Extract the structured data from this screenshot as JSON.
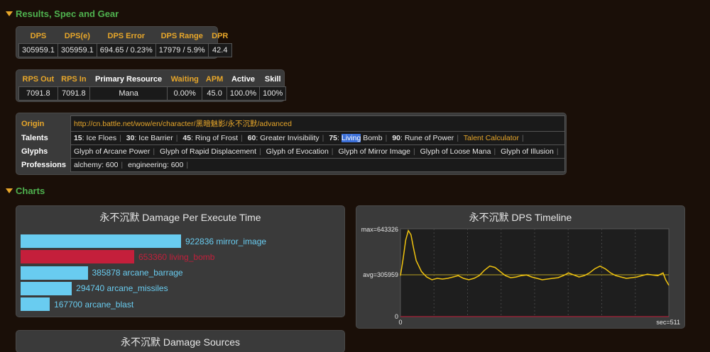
{
  "sections": {
    "results": "Results, Spec and Gear",
    "charts": "Charts"
  },
  "dps_table": {
    "headers": [
      "DPS",
      "DPS(e)",
      "DPS Error",
      "DPS Range",
      "DPR"
    ],
    "values": [
      "305959.1",
      "305959.1",
      "694.65 / 0.23%",
      "17979 / 5.9%",
      "42.4"
    ]
  },
  "rps_table": {
    "headers": [
      "RPS Out",
      "RPS In",
      "Primary Resource",
      "Waiting",
      "APM",
      "Active",
      "Skill"
    ],
    "values": [
      "7091.8",
      "7091.8",
      "Mana",
      "0.00%",
      "45.0",
      "100.0%",
      "100%"
    ]
  },
  "info": {
    "origin_label": "Origin",
    "origin_url": "http://cn.battle.net/wow/en/character/黑暗魅影/永不沉默/advanced",
    "talents_label": "Talents",
    "talents": [
      {
        "level": "15",
        "name": "Ice Floes"
      },
      {
        "level": "30",
        "name": "Ice Barrier"
      },
      {
        "level": "45",
        "name": "Ring of Frost"
      },
      {
        "level": "60",
        "name": "Greater Invisibility"
      },
      {
        "level": "75",
        "name_hl": "Living",
        "name_rest": " Bomb"
      },
      {
        "level": "90",
        "name": "Rune of Power"
      }
    ],
    "talent_calc": "Talent Calculator",
    "glyphs_label": "Glyphs",
    "glyphs": [
      "Glyph of Arcane Power",
      "Glyph of Rapid Displacement",
      "Glyph of Evocation",
      "Glyph of Mirror Image",
      "Glyph of Loose Mana",
      "Glyph of Illusion"
    ],
    "professions_label": "Professions",
    "professions": [
      "alchemy: 600",
      "engineering: 600"
    ]
  },
  "colors": {
    "bar_blue": "#69ccf0",
    "bar_red": "#c41f3b",
    "line_yellow": "#f1c40f",
    "avg_line": "#b8a020",
    "zero_line": "#c41f3b"
  },
  "chart_data": [
    {
      "type": "bar",
      "title": "永不沉默 Damage Per Execute Time",
      "categories": [
        "mirror_image",
        "living_bomb",
        "arcane_barrage",
        "arcane_missiles",
        "arcane_blast"
      ],
      "values": [
        922836,
        653360,
        385878,
        294740,
        167700
      ],
      "value_labels": [
        "922836",
        "653360",
        "385878",
        "294740",
        "167700"
      ],
      "highlight_index": 1
    },
    {
      "type": "line",
      "title": "永不沉默 DPS Timeline",
      "max_label": "max=643326",
      "avg_label": "avg=305959",
      "zero_label": "0",
      "x_start_label": "0",
      "x_end_label": "sec=511",
      "ylim": [
        0,
        643326
      ],
      "xlim": [
        0,
        511
      ],
      "avg": 305959,
      "x": [
        0,
        5,
        10,
        15,
        20,
        25,
        30,
        40,
        50,
        60,
        70,
        80,
        90,
        100,
        110,
        120,
        130,
        140,
        150,
        160,
        170,
        180,
        190,
        200,
        210,
        220,
        230,
        240,
        250,
        260,
        270,
        280,
        290,
        300,
        310,
        320,
        330,
        340,
        350,
        360,
        370,
        380,
        390,
        400,
        410,
        420,
        430,
        440,
        450,
        460,
        470,
        480,
        490,
        500,
        505,
        511
      ],
      "y": [
        300000,
        420000,
        560000,
        630000,
        600000,
        500000,
        410000,
        330000,
        290000,
        270000,
        280000,
        275000,
        280000,
        290000,
        300000,
        280000,
        270000,
        280000,
        300000,
        340000,
        370000,
        360000,
        330000,
        300000,
        285000,
        290000,
        300000,
        305000,
        290000,
        280000,
        270000,
        275000,
        280000,
        285000,
        300000,
        320000,
        305000,
        290000,
        300000,
        320000,
        350000,
        370000,
        350000,
        320000,
        300000,
        290000,
        280000,
        285000,
        290000,
        300000,
        310000,
        305000,
        300000,
        320000,
        270000,
        230000
      ]
    }
  ],
  "partial_chart_title": "永不沉默 Damage Sources"
}
